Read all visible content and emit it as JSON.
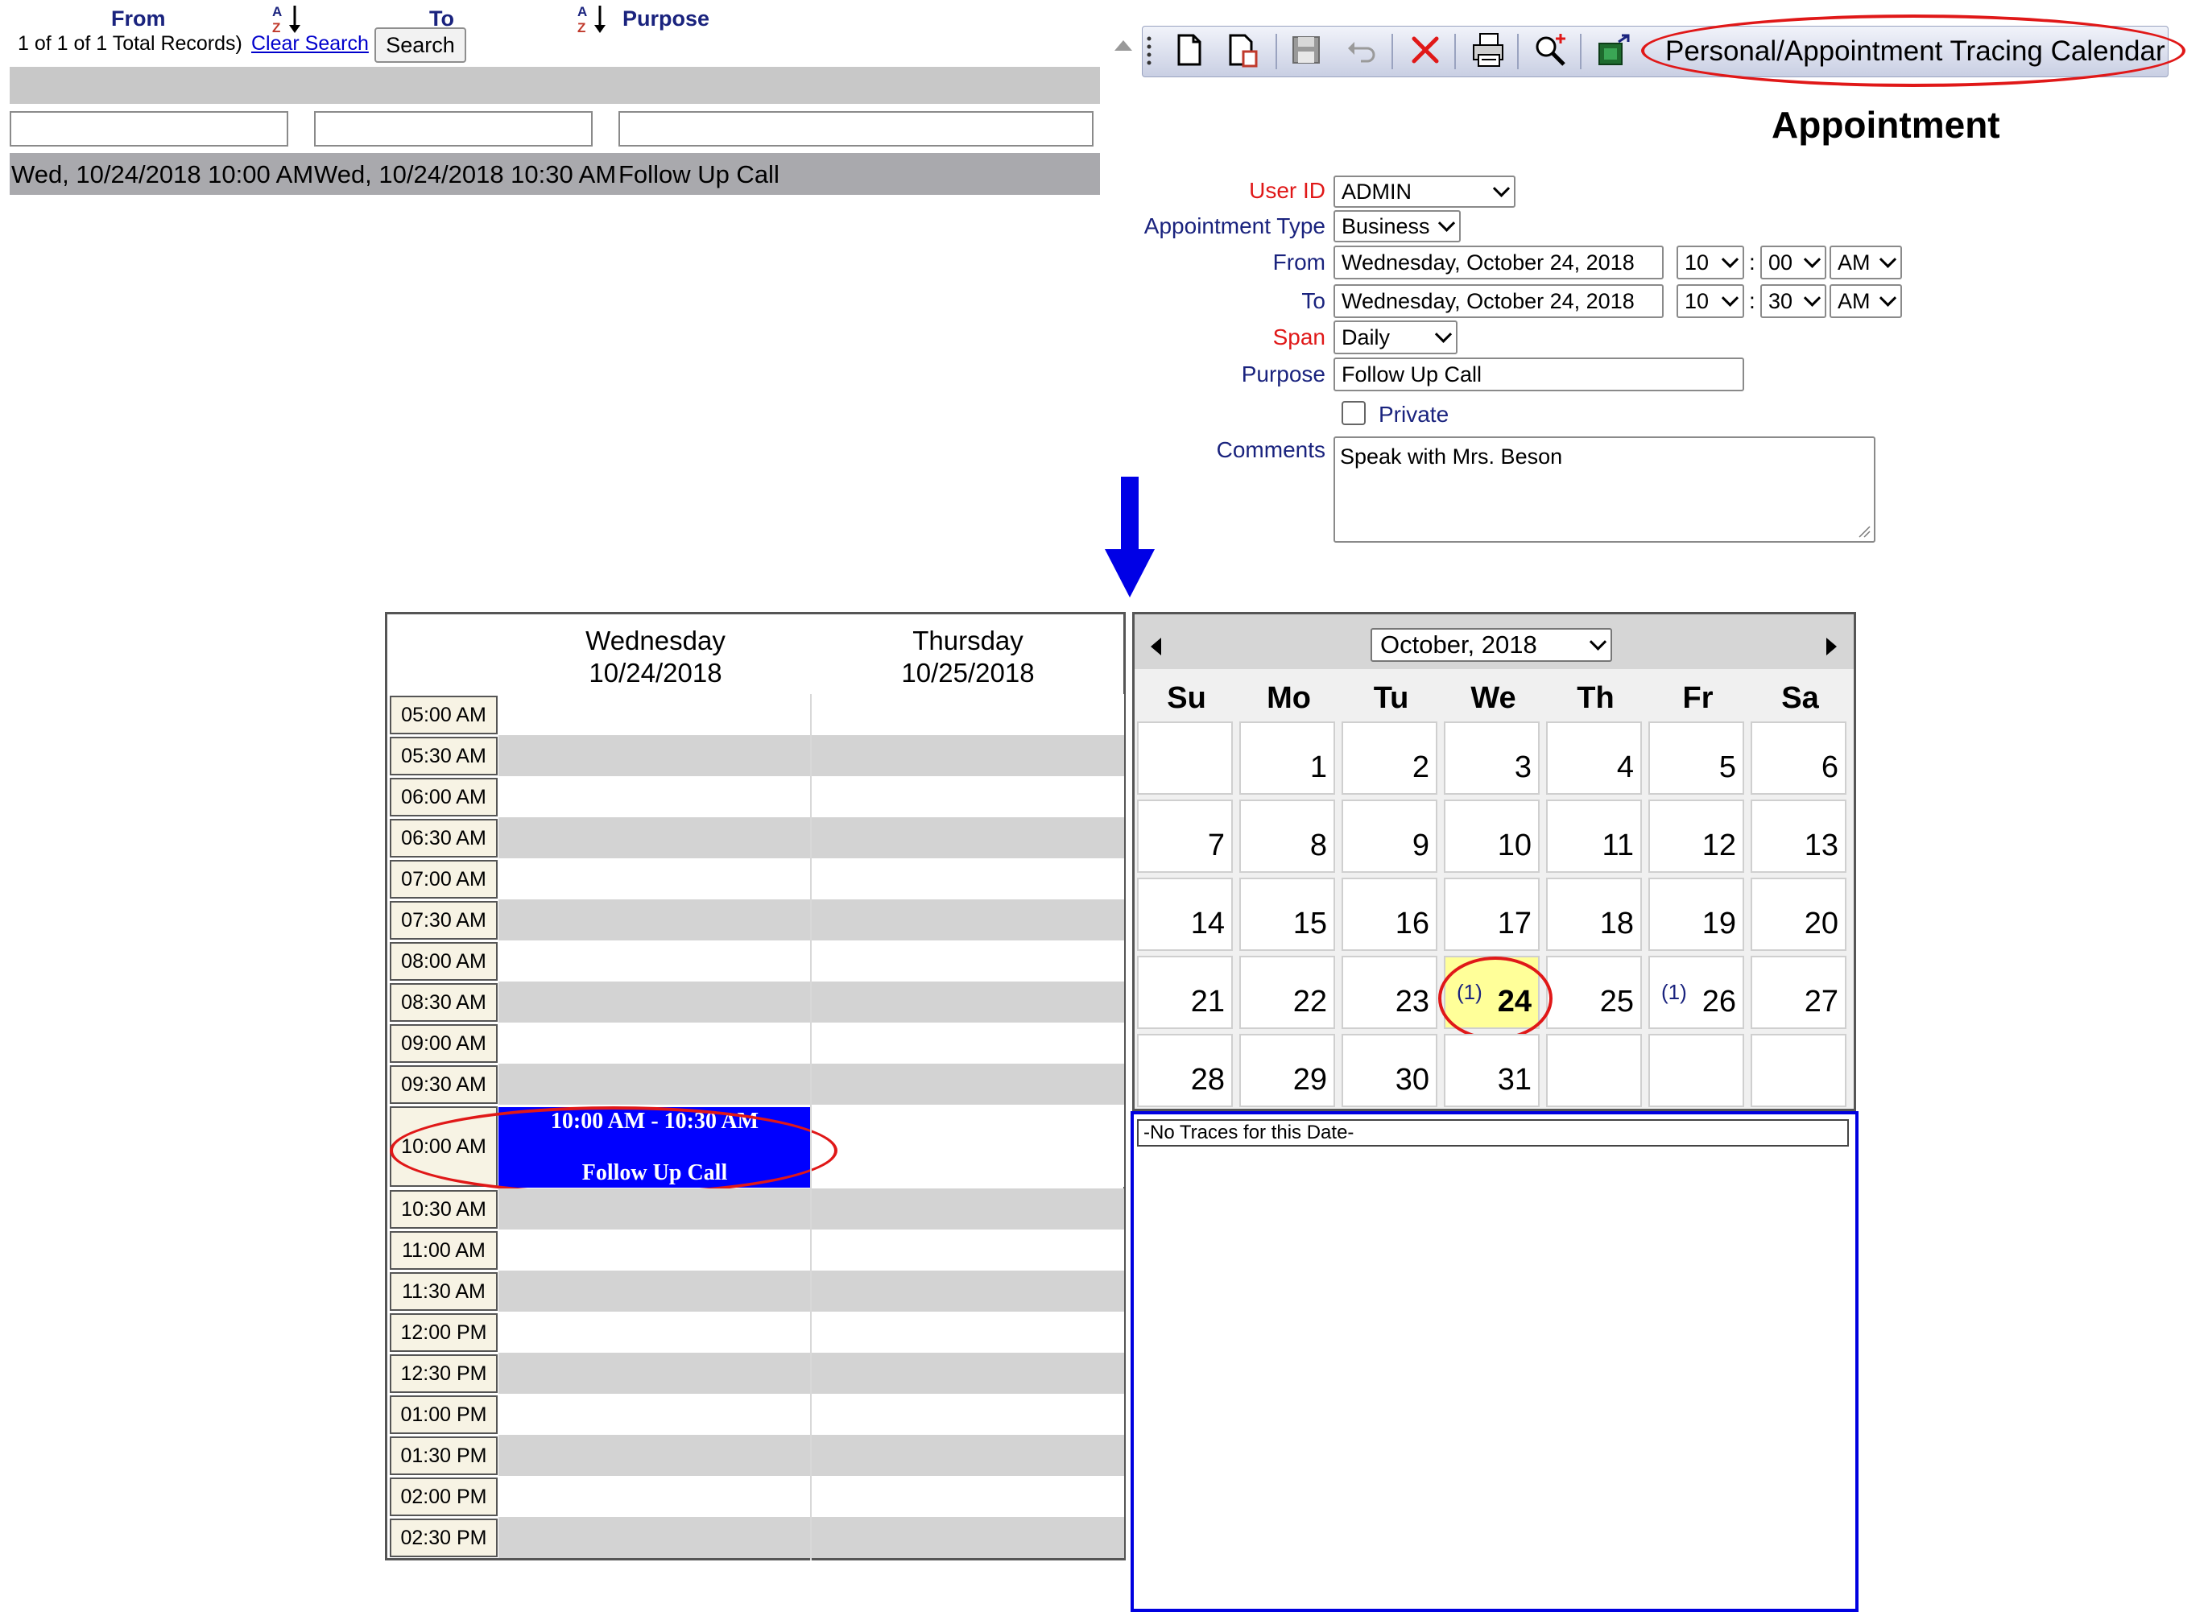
{
  "search_list": {
    "record_count": "1 of 1 of 1 Total Records)",
    "clear_search": "Clear Search",
    "search_button": "Search",
    "columns": [
      "From",
      "To",
      "Purpose"
    ],
    "rows": [
      {
        "from": "Wed, 10/24/2018 10:00 AM",
        "to": "Wed, 10/24/2018 10:30 AM",
        "purpose": "Follow Up Call"
      }
    ]
  },
  "toolbar": {
    "title": "Personal/Appointment Tracing Calendar",
    "icons": [
      "new-icon",
      "copy-icon",
      "save-icon",
      "undo-icon",
      "delete-icon",
      "print-icon",
      "search-icon",
      "export-icon"
    ]
  },
  "form": {
    "title": "Appointment",
    "user_id_label": "User ID",
    "user_id": "ADMIN",
    "appt_type_label": "Appointment Type",
    "appt_type": "Business",
    "from_label": "From",
    "from_date": "Wednesday, October 24, 2018",
    "from_hour": "10",
    "from_min": "00",
    "from_ampm": "AM",
    "to_label": "To",
    "to_date": "Wednesday, October 24, 2018",
    "to_hour": "10",
    "to_min": "30",
    "to_ampm": "AM",
    "span_label": "Span",
    "span": "Daily",
    "purpose_label": "Purpose",
    "purpose": "Follow Up Call",
    "private_label": "Private",
    "private_checked": false,
    "comments_label": "Comments",
    "comments": "Speak with Mrs. Beson",
    "colon": ":"
  },
  "schedule": {
    "day1_name": "Wednesday",
    "day1_date": "10/24/2018",
    "day2_name": "Thursday",
    "day2_date": "10/25/2018",
    "times": [
      "05:00 AM",
      "05:30 AM",
      "06:00 AM",
      "06:30 AM",
      "07:00 AM",
      "07:30 AM",
      "08:00 AM",
      "08:30 AM",
      "09:00 AM",
      "09:30 AM",
      "10:00 AM",
      "10:30 AM",
      "11:00 AM",
      "11:30 AM",
      "12:00 PM",
      "12:30 PM",
      "01:00 PM",
      "01:30 PM",
      "02:00 PM",
      "02:30 PM"
    ],
    "event": {
      "time": "10:00 AM - 10:30 AM",
      "title": "Follow Up Call",
      "color": "#0000ff"
    }
  },
  "calendar": {
    "month_label": "October, 2018",
    "weekdays": [
      "Su",
      "Mo",
      "Tu",
      "We",
      "Th",
      "Fr",
      "Sa"
    ],
    "weeks": [
      [
        "",
        "1",
        "2",
        "3",
        "4",
        "5",
        "6"
      ],
      [
        "7",
        "8",
        "9",
        "10",
        "11",
        "12",
        "13"
      ],
      [
        "14",
        "15",
        "16",
        "17",
        "18",
        "19",
        "20"
      ],
      [
        "21",
        "22",
        "23",
        "24",
        "25",
        "26",
        "27"
      ],
      [
        "28",
        "29",
        "30",
        "31",
        "",
        "",
        ""
      ]
    ],
    "counts": {
      "24": "(1)",
      "26": "(1)"
    },
    "selected_day": "24",
    "highlight_color": "#ffff99"
  },
  "traces": {
    "message": "-No Traces for this Date-"
  }
}
